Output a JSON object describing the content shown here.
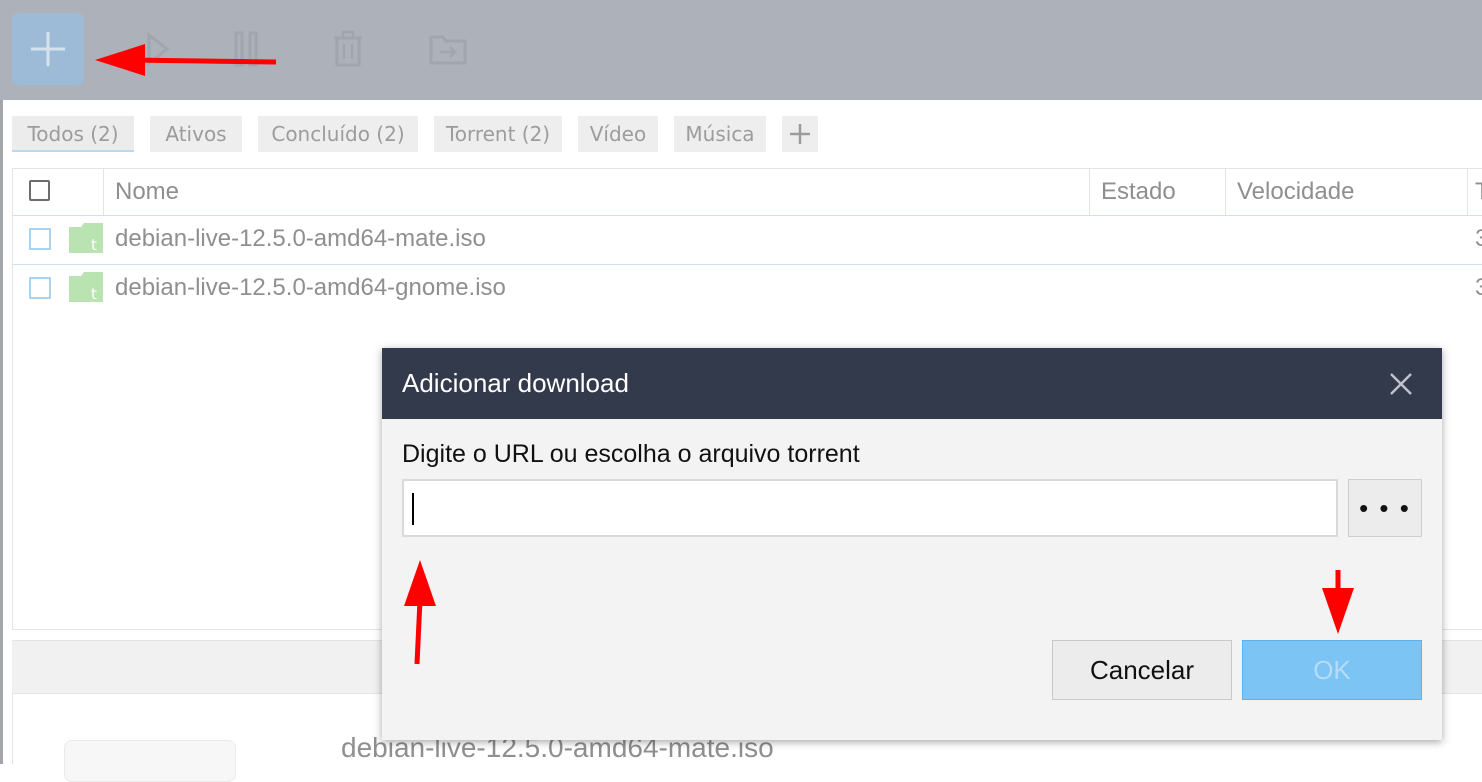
{
  "toolbar": {
    "buttons": [
      {
        "icon": "plus-icon",
        "state": "highlighted"
      },
      {
        "icon": "play-icon"
      },
      {
        "icon": "pause-icon"
      },
      {
        "icon": "trash-icon"
      },
      {
        "icon": "move-to-folder-icon"
      }
    ]
  },
  "tabs": [
    {
      "label": "Todos (2)",
      "active": true
    },
    {
      "label": "Ativos"
    },
    {
      "label": "Concluído (2)"
    },
    {
      "label": "Torrent (2)"
    },
    {
      "label": "Vídeo"
    },
    {
      "label": "Música"
    }
  ],
  "table": {
    "columns": [
      "Nome",
      "Estado",
      "Velocidade",
      "T"
    ],
    "rows": [
      {
        "name": "debian-live-12.5.0-amd64-mate.iso",
        "icon": "torrent-folder-icon",
        "trailing": "3"
      },
      {
        "name": "debian-live-12.5.0-amd64-gnome.iso",
        "icon": "torrent-folder-icon",
        "trailing": "3"
      }
    ]
  },
  "detail": {
    "filename": "debian-live-12.5.0-amd64-mate.iso"
  },
  "dialog": {
    "title": "Adicionar download",
    "label": "Digite o URL ou escolha o arquivo torrent",
    "url_value": "",
    "browse_label": "• • •",
    "cancel_label": "Cancelar",
    "ok_label": "OK"
  },
  "colors": {
    "toolbar_bg": "#adb2ba",
    "dialog_header": "#333a4c",
    "ok_button": "#7cc4f4",
    "annotation_arrow": "#ff0000",
    "torrent_icon": "#b9e3b0"
  }
}
